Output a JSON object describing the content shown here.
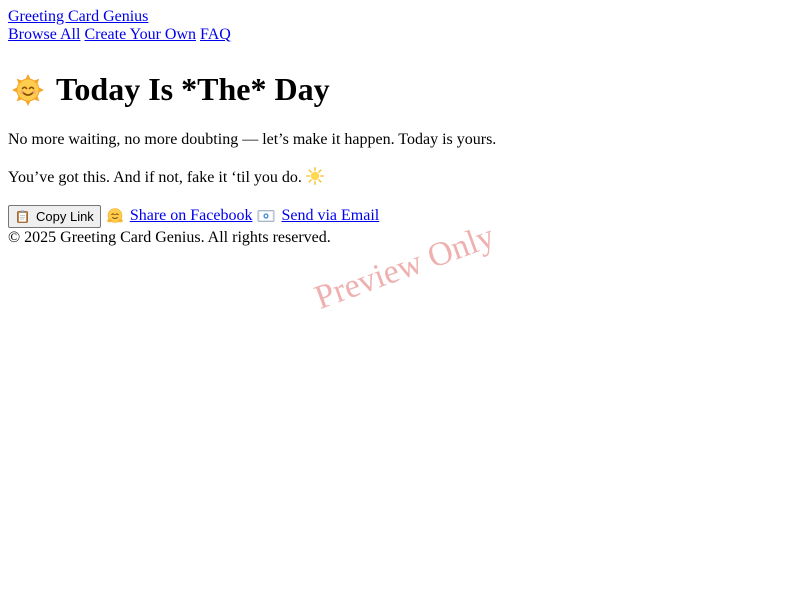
{
  "header": {
    "brand": "Greeting Card Genius",
    "nav": [
      {
        "label": "Browse All"
      },
      {
        "label": "Create Your Own"
      },
      {
        "label": "FAQ"
      }
    ]
  },
  "card": {
    "title": "Today Is *The* Day",
    "title_icon": "sun-face-icon",
    "line1": "No more waiting, no more doubting — let’s make it happen. Today is yours.",
    "line2": "You’ve got this. And if not, fake it ‘til you do.",
    "line2_icon": "sun-icon"
  },
  "share": {
    "copy_label": "Copy Link",
    "copy_icon": "clipboard-icon",
    "facebook_label": "Share on Facebook",
    "facebook_icon": "hugging-face-icon",
    "email_label": "Send via Email",
    "email_icon": "envelope-icon"
  },
  "footer": {
    "text": "© 2025 Greeting Card Genius. All rights reserved."
  },
  "watermark": {
    "text": "Preview Only"
  },
  "colors": {
    "link": "#0000ee",
    "watermark": "#dc5050",
    "button_bg": "#efefef"
  }
}
